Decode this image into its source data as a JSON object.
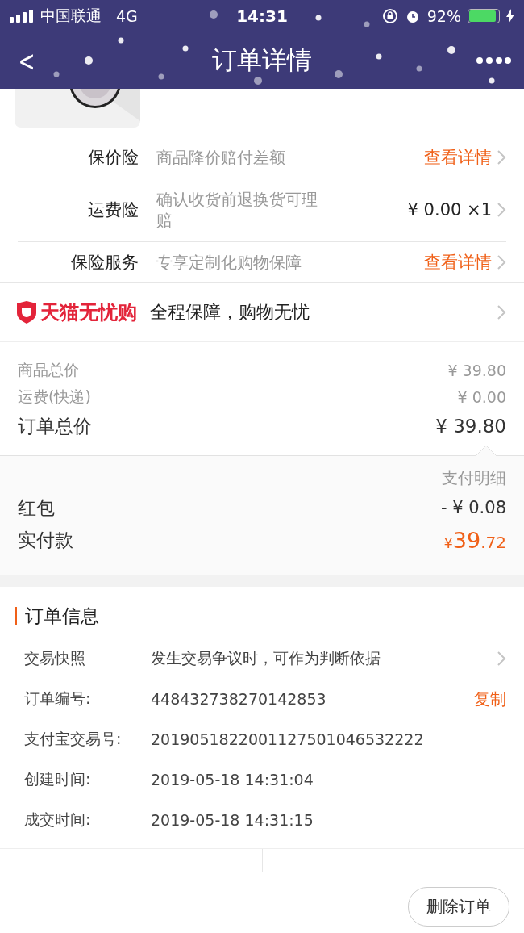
{
  "status_bar": {
    "carrier": "中国联通",
    "network": "4G",
    "time": "14:31",
    "battery_text": "92%"
  },
  "nav": {
    "back": "<",
    "title": "订单详情"
  },
  "insurance": [
    {
      "label": "保价险",
      "desc": "商品降价赔付差额",
      "action": "查看详情",
      "kind": "link"
    },
    {
      "label": "运费险",
      "desc": "确认收货前退换货可理赔",
      "action": "¥ 0.00 ×1",
      "kind": "value"
    },
    {
      "label": "保险服务",
      "desc": "专享定制化购物保障",
      "action": "查看详情",
      "kind": "link"
    }
  ],
  "guarantee": {
    "brand": "天猫无忧购",
    "text": "全程保障，购物无忧"
  },
  "prices": [
    {
      "label": "商品总价",
      "value": "¥ 39.80",
      "kind": "minor"
    },
    {
      "label": "运费(快递)",
      "value": "¥ 0.00",
      "kind": "minor"
    },
    {
      "label": "订单总价",
      "value": "¥ 39.80",
      "kind": "total"
    }
  ],
  "payment": {
    "title": "支付明细",
    "discount_label": "红包",
    "discount_value": "- ¥ 0.08",
    "paid_label": "实付款",
    "paid_currency": "¥",
    "paid_int": "39",
    "paid_dec": ".72"
  },
  "order_info": {
    "title": "订单信息",
    "rows": [
      {
        "label": "交易快照",
        "value": "发生交易争议时，可作为判断依据",
        "kind": "link"
      },
      {
        "label": "订单编号:",
        "value": "448432738270142853",
        "action": "复制",
        "kind": "copy"
      },
      {
        "label": "支付宝交易号:",
        "value": "2019051822001127501046532222",
        "kind": "plain"
      },
      {
        "label": "创建时间:",
        "value": "2019-05-18 14:31:04",
        "kind": "plain"
      },
      {
        "label": "成交时间:",
        "value": "2019-05-18 14:31:15",
        "kind": "plain"
      }
    ]
  },
  "footer": {
    "button": "删除订单"
  }
}
